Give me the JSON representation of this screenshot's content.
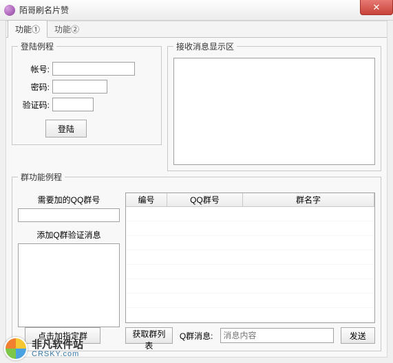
{
  "window": {
    "title": "陌哥刷名片赞",
    "close_symbol": "✕"
  },
  "tabs": {
    "tab1": "功能①",
    "tab2": "功能②"
  },
  "login": {
    "legend": "登陆例程",
    "account_label": "帐号:",
    "password_label": "密码:",
    "captcha_label": "验证码:",
    "account_value": "",
    "password_value": "",
    "captcha_value": "",
    "login_button": "登陆"
  },
  "recv": {
    "legend": "接收消息显示区"
  },
  "gfunc": {
    "legend": "群功能例程",
    "need_qq_label": "需要加的QQ群号",
    "need_qq_value": "",
    "verify_label": "添加Q群验证消息",
    "verify_value": "",
    "add_group_button": "点击加指定群",
    "get_list_button": "获取群列表",
    "msg_label": "Q群消息:",
    "msg_placeholder": "消息内容",
    "msg_value": "",
    "send_button": "发送",
    "columns": {
      "id": "编号",
      "qq": "QQ群号",
      "name": "群名字"
    },
    "rows": []
  },
  "watermark": {
    "cn": "非凡软件站",
    "en": "CRSKY.com"
  }
}
